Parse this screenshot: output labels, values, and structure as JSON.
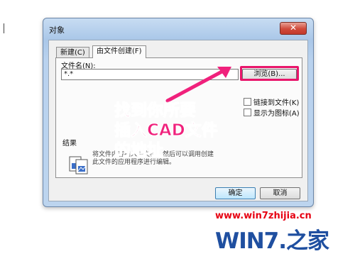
{
  "dialog": {
    "title": "对象",
    "close_label": "✕",
    "tabs": [
      {
        "label": "新建(C)",
        "selected": false
      },
      {
        "label": "由文件创建(F)",
        "selected": true
      }
    ],
    "filename_label": "文件名(N):",
    "filename_value": "*.*",
    "browse_label": "浏览(B)...",
    "link_label": "链接到文件(K)",
    "display_icon_label": "显示为图标(A)",
    "result_label": "结果",
    "result_text_line1": "将文件内容插入到文档，然后可以调用创建",
    "result_text_line2": "此文件的应用程序进行编辑。",
    "ok_label": "确定",
    "cancel_label": "取消"
  },
  "annotation": {
    "line1": "找到你所要",
    "line2": "插入CAD文件",
    "line3": "的地址",
    "color": "#f0217c"
  },
  "watermark": {
    "url": "www.win7zhijia.cn",
    "logo_text": "WIN7.之家",
    "url_color": "#e60012",
    "logo_color": "#1f4fa0"
  }
}
